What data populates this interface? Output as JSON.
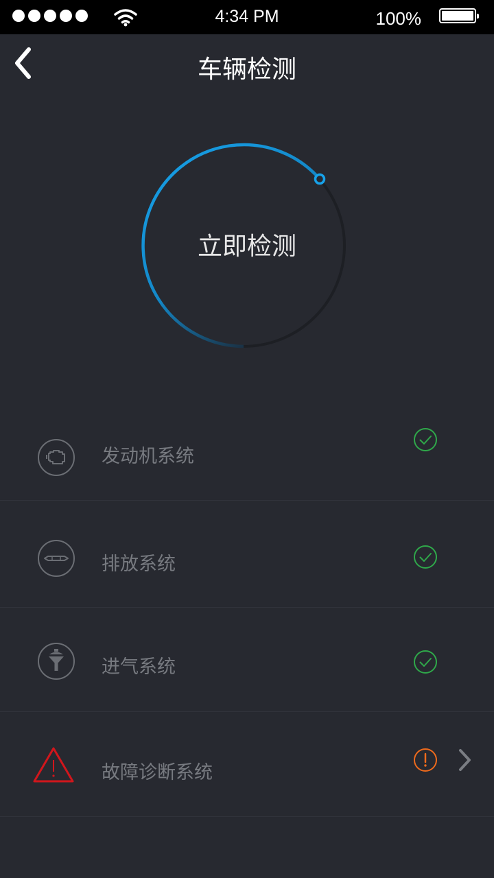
{
  "status_bar": {
    "time": "4:34 PM",
    "battery_percent": "100%",
    "signal_bars": 5,
    "icons": [
      "signal-dots-icon",
      "wifi-icon",
      "battery-icon"
    ]
  },
  "nav": {
    "title": "车辆检测",
    "back_icon": "chevron-left-icon"
  },
  "detect": {
    "label": "立即检测",
    "accent_color": "#1a9ce2"
  },
  "systems": [
    {
      "label": "发动机系统",
      "icon": "engine-icon",
      "status": "ok",
      "status_icon": "check-circle-icon"
    },
    {
      "label": "排放系统",
      "icon": "exhaust-icon",
      "status": "ok",
      "status_icon": "check-circle-icon"
    },
    {
      "label": "进气系统",
      "icon": "air-intake-icon",
      "status": "ok",
      "status_icon": "check-circle-icon"
    },
    {
      "label": "故障诊断系统",
      "icon": "warning-triangle-icon",
      "status": "warning",
      "status_icon": "exclamation-circle-icon",
      "has_detail": true
    }
  ],
  "colors": {
    "background": "#272930",
    "ok": "#2fa84a",
    "warning": "#ee6a1c",
    "danger": "#d1161c",
    "muted_text": "#777a80"
  }
}
